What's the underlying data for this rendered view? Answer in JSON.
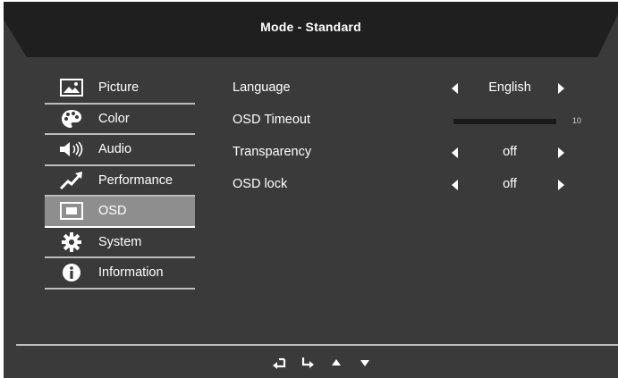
{
  "header": {
    "title": "Mode - Standard"
  },
  "sidebar": {
    "items": [
      {
        "label": "Picture",
        "icon": "picture-icon",
        "selected": false
      },
      {
        "label": "Color",
        "icon": "palette-icon",
        "selected": false
      },
      {
        "label": "Audio",
        "icon": "speaker-icon",
        "selected": false
      },
      {
        "label": "Performance",
        "icon": "performance-icon",
        "selected": false
      },
      {
        "label": "OSD",
        "icon": "osd-icon",
        "selected": true
      },
      {
        "label": "System",
        "icon": "gear-icon",
        "selected": false
      },
      {
        "label": "Information",
        "icon": "info-icon",
        "selected": false
      }
    ]
  },
  "settings": {
    "language": {
      "label": "Language",
      "value": "English"
    },
    "osd_timeout": {
      "label": "OSD Timeout",
      "value": "10",
      "level": 0
    },
    "transparency": {
      "label": "Transparency",
      "value": "off"
    },
    "osd_lock": {
      "label": "OSD lock",
      "value": "off"
    }
  },
  "nav_keys": [
    "return-icon",
    "enter-icon",
    "up-triangle-icon",
    "down-triangle-icon"
  ],
  "colors": {
    "background": "#3a3a3a",
    "header": "#1f1f1f",
    "selected_item": "#8e8e8e",
    "divider": "#bdbdbd",
    "text": "#ffffff"
  }
}
